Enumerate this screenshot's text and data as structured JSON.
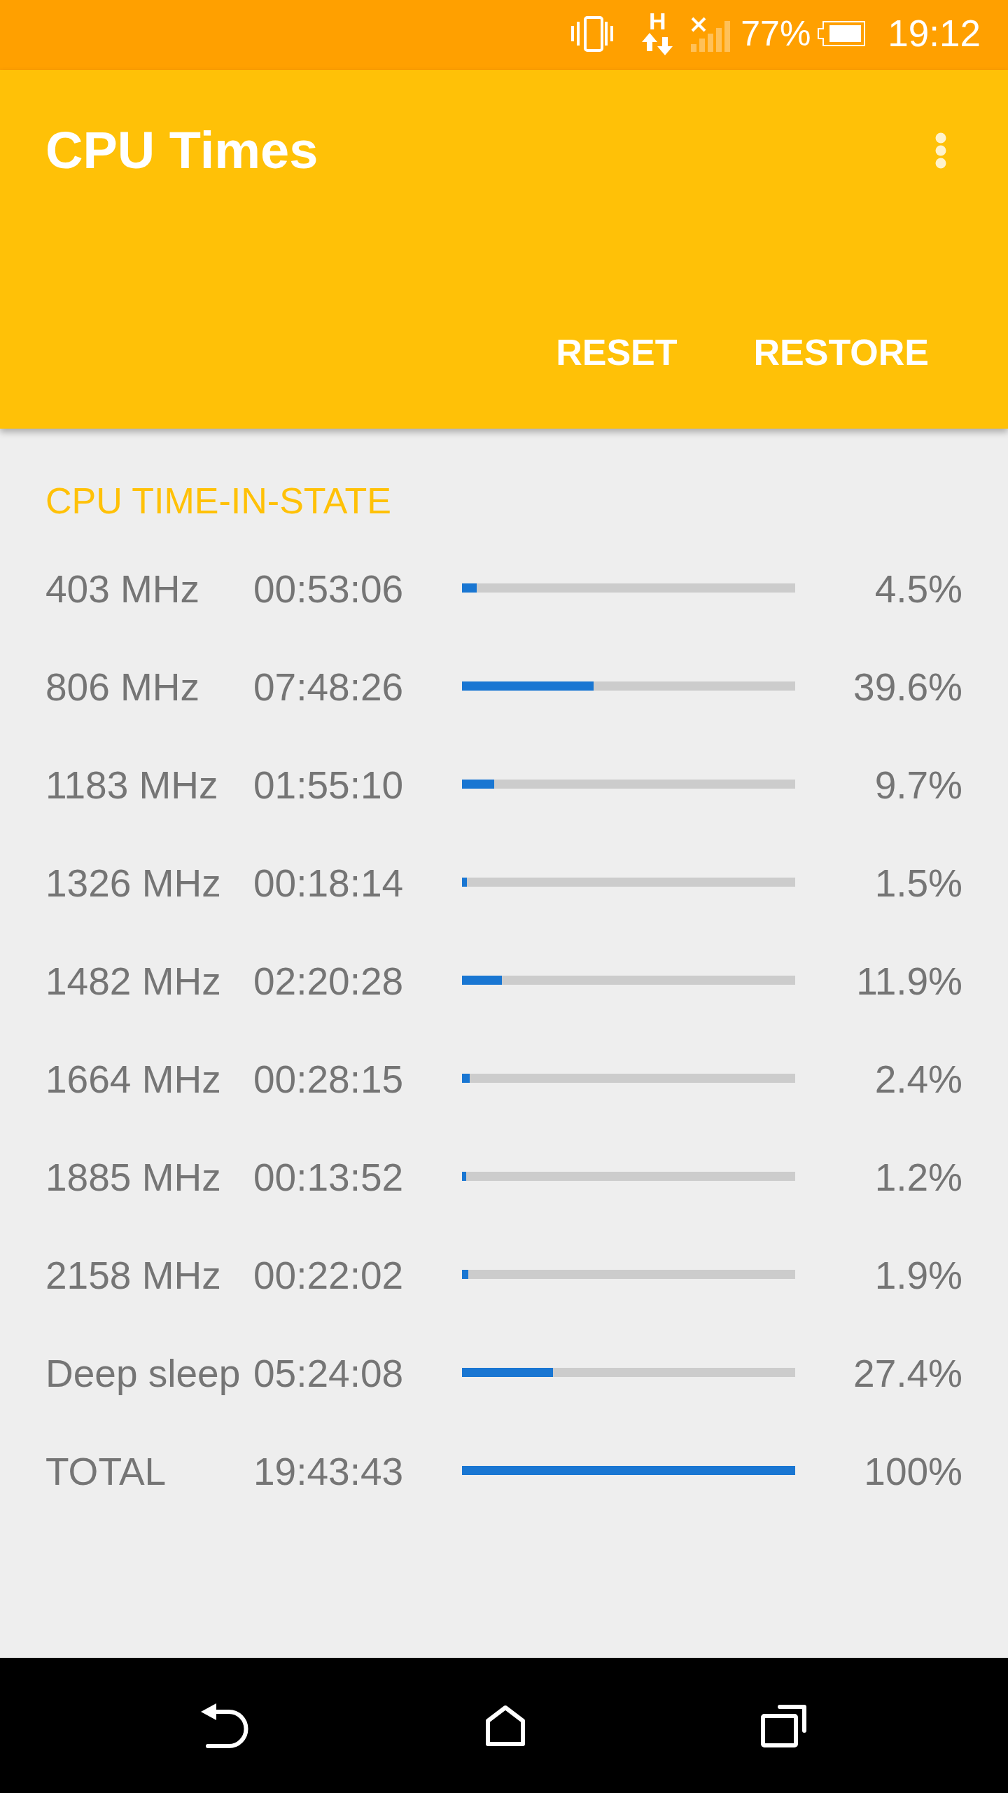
{
  "status_bar": {
    "network_type": "H",
    "battery": "77%",
    "time": "19:12"
  },
  "app_bar": {
    "title": "CPU Times",
    "actions": [
      "RESET",
      "RESTORE"
    ]
  },
  "section": {
    "title": "CPU TIME-IN-STATE",
    "rows": [
      {
        "state": "403 MHz",
        "time": "00:53:06",
        "level": 0.045,
        "percent": "4.5%"
      },
      {
        "state": "806 MHz",
        "time": "07:48:26",
        "level": 0.396,
        "percent": "39.6%"
      },
      {
        "state": "1183 MHz",
        "time": "01:55:10",
        "level": 0.097,
        "percent": "9.7%"
      },
      {
        "state": "1326 MHz",
        "time": "00:18:14",
        "level": 0.015,
        "percent": "1.5%"
      },
      {
        "state": "1482 MHz",
        "time": "02:20:28",
        "level": 0.119,
        "percent": "11.9%"
      },
      {
        "state": "1664 MHz",
        "time": "00:28:15",
        "level": 0.024,
        "percent": "2.4%"
      },
      {
        "state": "1885 MHz",
        "time": "00:13:52",
        "level": 0.012,
        "percent": "1.2%"
      },
      {
        "state": "2158 MHz",
        "time": "00:22:02",
        "level": 0.019,
        "percent": "1.9%"
      },
      {
        "state": "Deep sleep",
        "time": "05:24:08",
        "level": 0.274,
        "percent": "27.4%"
      },
      {
        "state": "TOTAL",
        "time": "19:43:43",
        "level": 1,
        "percent": "100%"
      }
    ]
  }
}
